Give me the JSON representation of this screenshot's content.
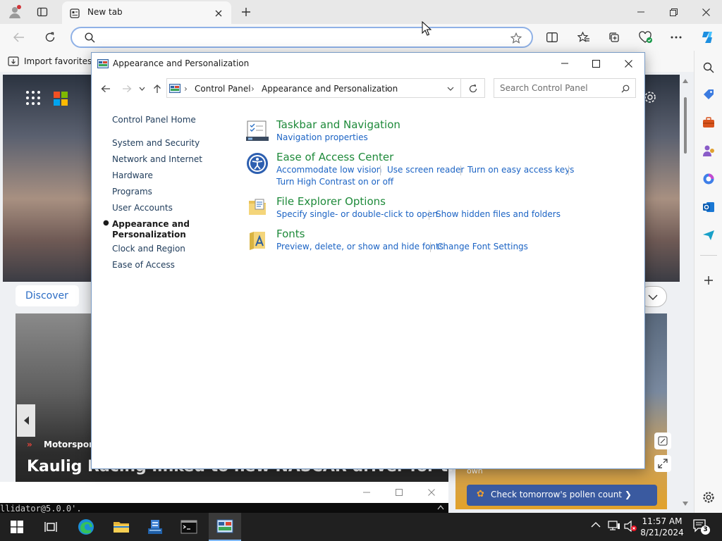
{
  "browser": {
    "tab_title": "New tab",
    "favorites_import": "Import favorites"
  },
  "msn": {
    "discover_label": "Discover",
    "news_category": "Motorsports",
    "news_headline": "Kaulig Racing linked to new NASCAR driver for the",
    "side_card_label": "own",
    "pollen_text": "Check tomorrow's pollen count ❯"
  },
  "terminal": {
    "text": "llidator@5.0.0'."
  },
  "control_panel": {
    "window_title": "Appearance and Personalization",
    "breadcrumb": [
      "Control Panel",
      "Appearance and Personalization"
    ],
    "search_placeholder": "Search Control Panel",
    "left_nav": [
      "Control Panel Home",
      "System and Security",
      "Network and Internet",
      "Hardware",
      "Programs",
      "User Accounts",
      "Appearance and Personalization",
      "Clock and Region",
      "Ease of Access"
    ],
    "active_nav_index": 6,
    "categories": [
      {
        "title": "Taskbar and Navigation",
        "icon": "taskbar-icon",
        "links": [
          "Navigation properties"
        ]
      },
      {
        "title": "Ease of Access Center",
        "icon": "ease-of-access-icon",
        "links": [
          "Accommodate low vision",
          "Use screen reader",
          "Turn on easy access keys",
          "Turn High Contrast on or off"
        ]
      },
      {
        "title": "File Explorer Options",
        "icon": "folder-options-icon",
        "links": [
          "Specify single- or double-click to open",
          "Show hidden files and folders"
        ]
      },
      {
        "title": "Fonts",
        "icon": "fonts-folder-icon",
        "links": [
          "Preview, delete, or show and hide fonts",
          "Change Font Settings"
        ]
      }
    ]
  },
  "taskbar": {
    "time": "11:57 AM",
    "date": "8/21/2024",
    "notification_count": "3"
  },
  "colors": {
    "accent": "#1b63c4",
    "category_green": "#1e8a3a",
    "taskbar": "#202020"
  }
}
